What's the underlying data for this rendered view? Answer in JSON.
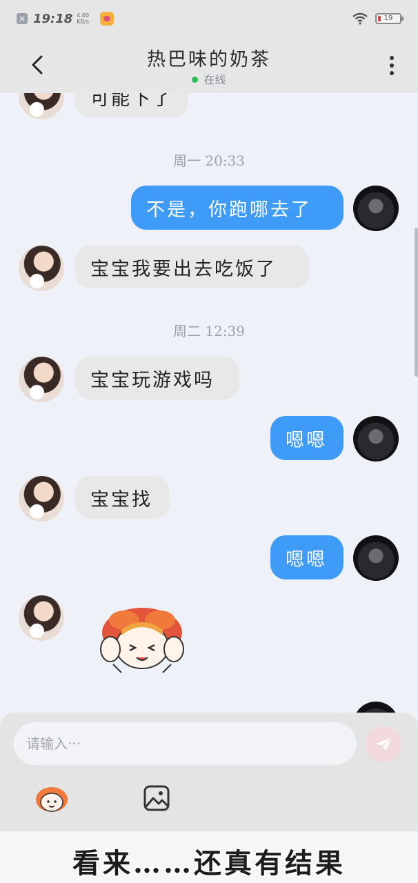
{
  "status_bar": {
    "time": "19:18",
    "net_speed_value": "4.60",
    "net_speed_unit": "KB/s",
    "battery_level": "19"
  },
  "header": {
    "title": "热巴味的奶茶",
    "status": "在线",
    "status_color": "#2fbf5a"
  },
  "messages": [
    {
      "side": "in",
      "type": "text",
      "text": "可能下了"
    },
    {
      "type": "time",
      "text": "周一 20:33"
    },
    {
      "side": "out",
      "type": "text",
      "text": "不是，你跑哪去了"
    },
    {
      "side": "in",
      "type": "text",
      "text": "宝宝我要出去吃饭了"
    },
    {
      "type": "time",
      "text": "周二 12:39"
    },
    {
      "side": "in",
      "type": "text",
      "text": "宝宝玩游戏吗"
    },
    {
      "side": "out",
      "type": "text",
      "text": "嗯嗯"
    },
    {
      "side": "in",
      "type": "text",
      "text": "宝宝找"
    },
    {
      "side": "out",
      "type": "text",
      "text": "嗯嗯"
    },
    {
      "side": "in",
      "type": "sticker",
      "sticker": "cartoon-girl-sticker"
    }
  ],
  "composer": {
    "placeholder": "请输入···",
    "send_icon": "send-icon",
    "emoji_icon": "emoji-icon",
    "image_icon": "image-icon"
  },
  "caption": "看来……还真有结果",
  "colors": {
    "bubble_out": "#3e9cf8",
    "bubble_in": "#e8e8e8",
    "background": "#eef2f8"
  }
}
